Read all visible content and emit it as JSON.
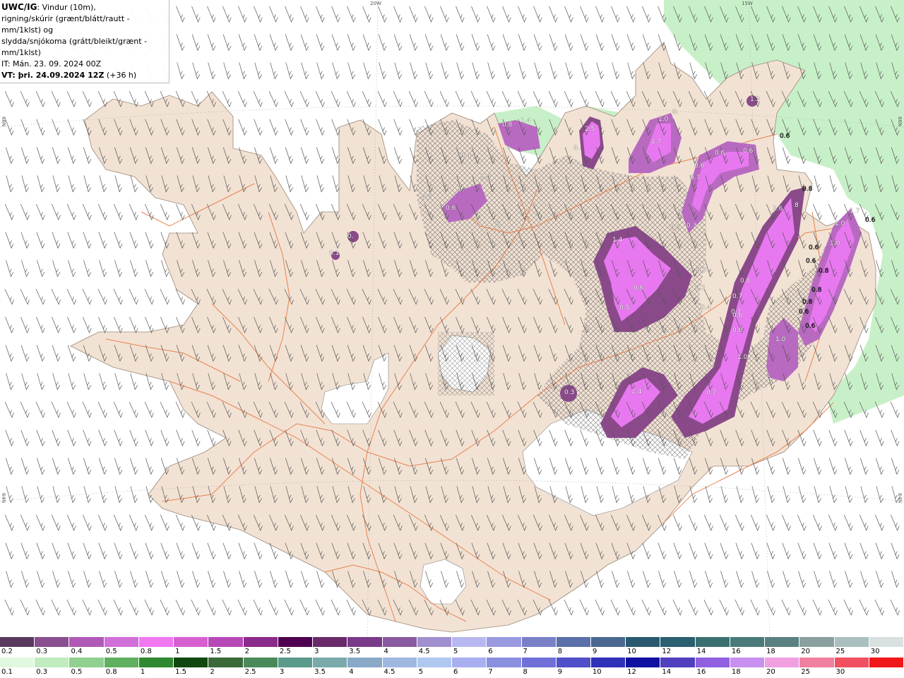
{
  "header": {
    "model": "UWC/IG",
    "desc_line1": ": Vindur (10m),",
    "desc_line2": "rigning/skúrir (grænt/blátt/rautt - mm/1klst) og",
    "desc_line3": "slydda/snjókoma (grátt/bleikt/grænt - mm/1klst)",
    "it_line": "IT: Mán. 23. 09. 2024 00Z",
    "vt_label": "VT: þri. 24.09.2024 12Z",
    "vt_extra": " (+36 h)"
  },
  "graticule": {
    "lon_top": [
      "20W",
      "15W"
    ],
    "lat_left": [
      "66N",
      "64N"
    ],
    "lat_right": [
      "66N",
      "64N"
    ]
  },
  "colors": {
    "land": "#f2e2d4",
    "ocean": "#ffffff",
    "roads": "#e87840",
    "glacier": "#ffffff",
    "snow_light": "#c870e8",
    "snow_dark": "#6a2a6a",
    "rain_light": "#c8f0c8",
    "rain_mid": "#58b858"
  },
  "precip_labels": {
    "north": [
      "0.8",
      "1.4",
      "2.5",
      "0.",
      "1.0",
      "1.7",
      "0.",
      "1.2",
      "0.6",
      "0.6",
      "0.6",
      "0.6",
      "0.7",
      "0.3",
      "0.3"
    ],
    "northwest": [
      "0.4",
      "1.0",
      "0.6",
      "0.",
      "0.5",
      "0.",
      "0.1",
      "0."
    ],
    "east": [
      "2.6",
      "0.8",
      "8",
      "1.0",
      "1.0",
      "1.7",
      "0.6",
      "0.6",
      "0.6",
      "0.8",
      "0.8",
      "0.8",
      "0.6",
      "0.6",
      "1.0",
      "1.0",
      "0.7",
      "0.6"
    ],
    "interior": [
      "1.4",
      "0.6",
      "0.5",
      "0.3",
      "0.3",
      "0.4",
      "0.7",
      "0.8",
      "1.4",
      "0.3",
      "0.7",
      "0.6"
    ]
  },
  "snow_scale": {
    "colors": [
      "#5a3a5e",
      "#8a4f8e",
      "#b05ab8",
      "#d070d8",
      "#f078f0",
      "#d660d2",
      "#b848b8",
      "#8a2a8a",
      "#500050",
      "#6a2a6a",
      "#7a3a8a",
      "#8a5aa0",
      "#a090d0",
      "#b8b8f0",
      "#9a9ae0",
      "#7a80c8",
      "#5a70a8",
      "#4a6890",
      "#2a5a70",
      "#2a6070",
      "#3a7070",
      "#4a7a7a",
      "#5a8080",
      "#8aa0a0",
      "#aac0c0",
      "#d8e0e0"
    ],
    "ticks": [
      "0.2",
      "0.3",
      "0.4",
      "0.5",
      "0.8",
      "1",
      "1.5",
      "2",
      "2.5",
      "3",
      "3.5",
      "4",
      "4.5",
      "5",
      "6",
      "7",
      "8",
      "9",
      "10",
      "12",
      "14",
      "16",
      "18",
      "20",
      "25",
      "30"
    ]
  },
  "rain_scale": {
    "colors": [
      "#e0f8e0",
      "#c0ecc0",
      "#90d090",
      "#60b060",
      "#308830",
      "#104810",
      "#3a6a3a",
      "#4a8a5a",
      "#5a9a8a",
      "#7aaaaa",
      "#8aa8c8",
      "#a0b8e0",
      "#b0c8f0",
      "#a8b0f0",
      "#8a90e0",
      "#7070d8",
      "#5050c8",
      "#3030b8",
      "#1010a0",
      "#5040c0",
      "#9060e0",
      "#c890f0",
      "#f0a0e0",
      "#f080a0",
      "#f05060",
      "#f01818"
    ],
    "ticks": [
      "0.1",
      "0.3",
      "0.5",
      "0.8",
      "1",
      "1.5",
      "2",
      "2.5",
      "3",
      "3.5",
      "4",
      "4.5",
      "5",
      "6",
      "7",
      "8",
      "9",
      "10",
      "12",
      "14",
      "16",
      "18",
      "20",
      "25",
      "30"
    ]
  }
}
